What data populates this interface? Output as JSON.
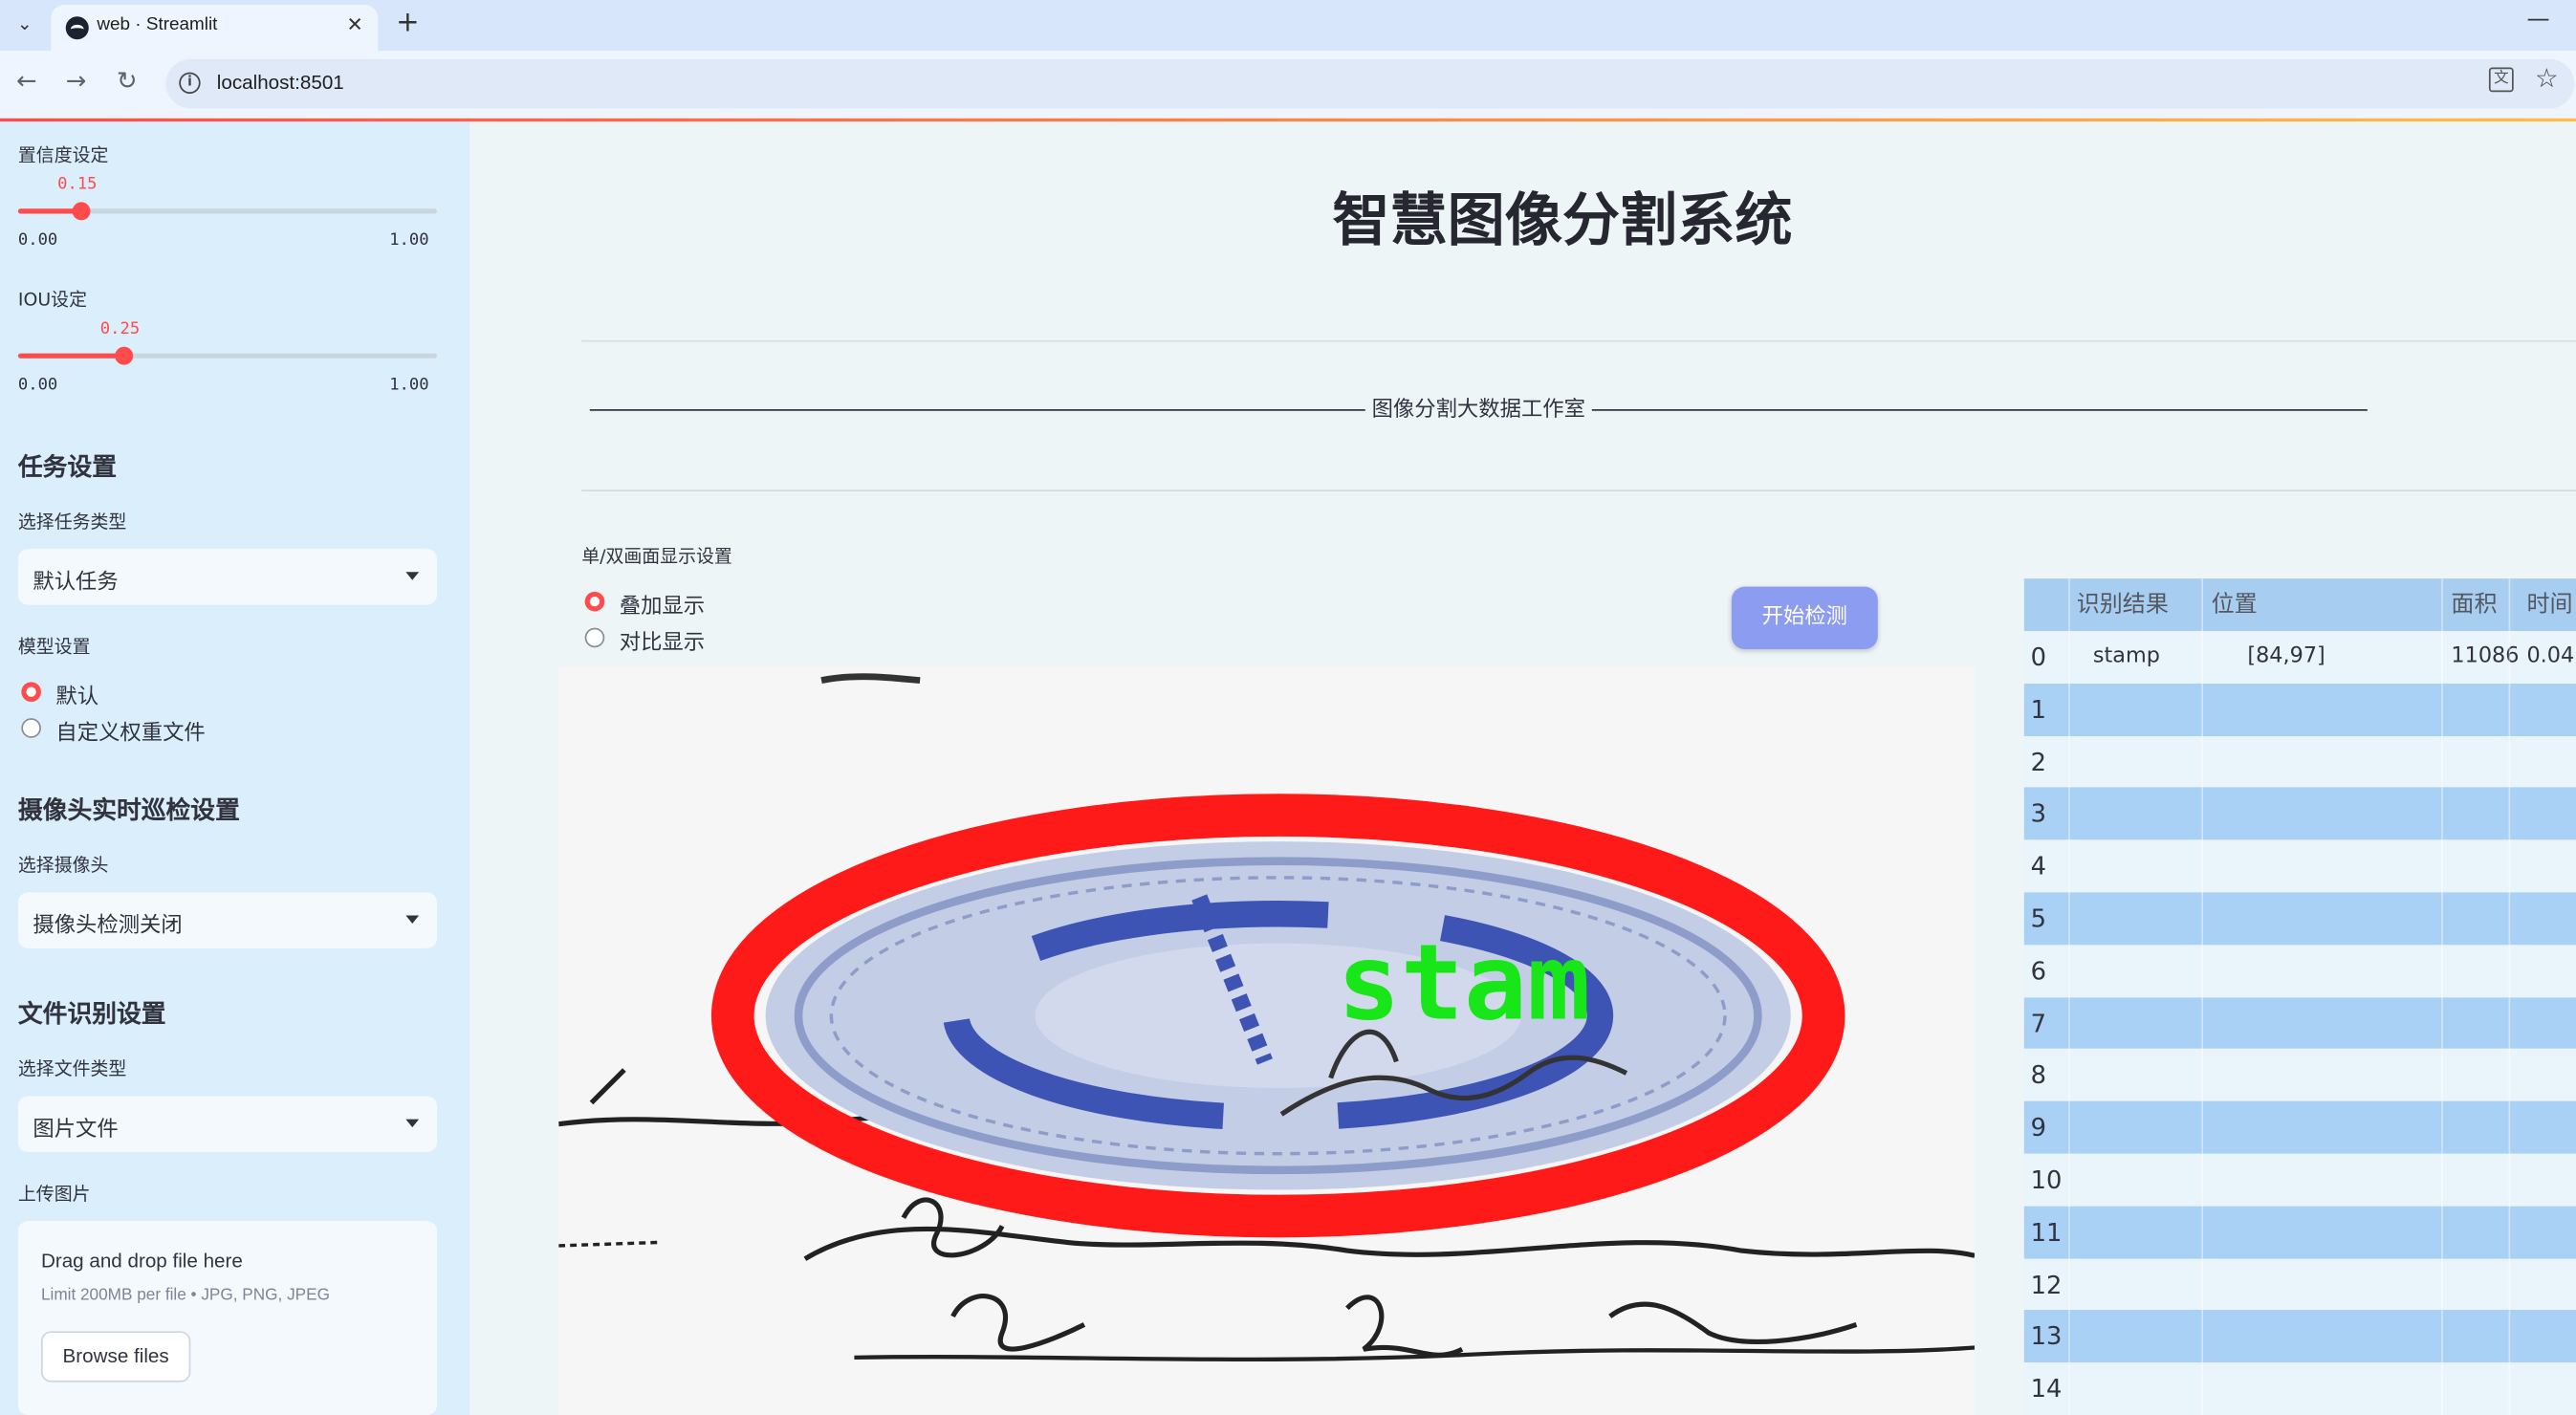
{
  "browser": {
    "tab_title": "web · Streamlit",
    "url": "localhost:8501"
  },
  "sidebar": {
    "confidence": {
      "label": "置信度设定",
      "value": "0.15",
      "min": "0.00",
      "max": "1.00",
      "fraction": 0.15
    },
    "iou": {
      "label": "IOU设定",
      "value": "0.25",
      "min": "0.00",
      "max": "1.00",
      "fraction": 0.25
    },
    "task_header": "任务设置",
    "task_type_label": "选择任务类型",
    "task_type_value": "默认任务",
    "model_label": "模型设置",
    "model_options": [
      "默认",
      "自定义权重文件"
    ],
    "model_selected": 0,
    "camera_header": "摄像头实时巡检设置",
    "camera_label": "选择摄像头",
    "camera_value": "摄像头检测关闭",
    "file_header": "文件识别设置",
    "file_type_label": "选择文件类型",
    "file_type_value": "图片文件",
    "upload_label": "上传图片",
    "dropzone_title": "Drag and drop file here",
    "dropzone_limit": "Limit 200MB per file • JPG, PNG, JPEG",
    "browse_label": "Browse files"
  },
  "main": {
    "title": "智慧图像分割系统",
    "subtitle": "图像分割大数据工作室",
    "display_mode_label": "单/双画面显示设置",
    "display_options": [
      "叠加显示",
      "对比显示"
    ],
    "display_selected": 0,
    "start_button": "开始检测",
    "detection_label": "stam",
    "colors": {
      "accent": "#ff4b4b",
      "mask_red": "#ff1a1a",
      "label_green": "#19e619",
      "button": "#8c9cf1"
    }
  },
  "table": {
    "columns": [
      "",
      "识别结果",
      "位置",
      "面积",
      "时间"
    ],
    "rows": [
      [
        "0",
        "stamp",
        "[84,97]",
        "11086",
        "0.04"
      ],
      [
        "1",
        "",
        "",
        "",
        ""
      ],
      [
        "2",
        "",
        "",
        "",
        ""
      ],
      [
        "3",
        "",
        "",
        "",
        ""
      ],
      [
        "4",
        "",
        "",
        "",
        ""
      ],
      [
        "5",
        "",
        "",
        "",
        ""
      ],
      [
        "6",
        "",
        "",
        "",
        ""
      ],
      [
        "7",
        "",
        "",
        "",
        ""
      ],
      [
        "8",
        "",
        "",
        "",
        ""
      ],
      [
        "9",
        "",
        "",
        "",
        ""
      ],
      [
        "10",
        "",
        "",
        "",
        ""
      ],
      [
        "11",
        "",
        "",
        "",
        ""
      ],
      [
        "12",
        "",
        "",
        "",
        ""
      ],
      [
        "13",
        "",
        "",
        "",
        ""
      ],
      [
        "14",
        "",
        "",
        "",
        ""
      ]
    ]
  }
}
